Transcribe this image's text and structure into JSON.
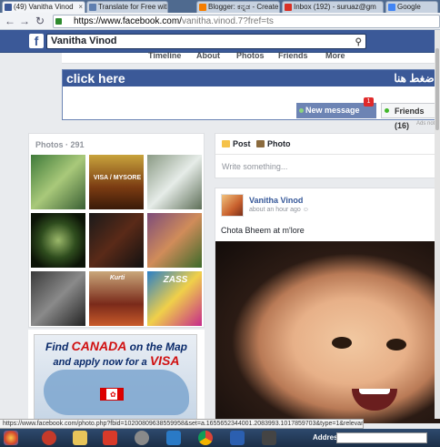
{
  "browser": {
    "tabs": [
      {
        "label": "(49) Vanitha Vinod",
        "color": "#3b5998"
      },
      {
        "label": "Translate for Free with Ka",
        "color": "#5f7fb0"
      },
      {
        "label": "Blogger: ಕನ್ನಡ - Create",
        "color": "#f57d00"
      },
      {
        "label": "Inbox (192) - suruaz@gm",
        "color": "#d93025"
      },
      {
        "label": "Google",
        "color": "#4285f4"
      }
    ],
    "url_host": "https://www.facebook.com/",
    "url_rest": "vanitha.vinod.7?fref=ts",
    "status_url": "https://www.facebook.com/photo.php?fbid=10200809638559958&set=a.1655652344001.2083993.1017859703&type=1&relevant_count=1"
  },
  "fb": {
    "search_value": "Vanitha Vinod",
    "logo": "f",
    "profile_nav": [
      "Timeline",
      "About",
      "Photos",
      "Friends",
      "More"
    ]
  },
  "ad_banner": {
    "click_here": "click here",
    "arabic": "اضغط هنا",
    "new_message": "New message",
    "badge": "1",
    "friends": "Friends (16)",
    "note": "Ads not b"
  },
  "photos": {
    "header": "Photos",
    "count": "· 291",
    "captions": [
      "",
      "VISA / MYSORE",
      "",
      "",
      "",
      "",
      "",
      "Kurti",
      "ZASS"
    ]
  },
  "canada_ad": {
    "line1a": "Find ",
    "line1b": "CANADA",
    "line1c": " on the Map",
    "line2": "and apply now for a ",
    "line2b": "VISA"
  },
  "composer": {
    "post_tab": "Post",
    "photo_tab": "Photo",
    "placeholder": "Write something..."
  },
  "post": {
    "author": "Vanitha Vinod",
    "time": "about an hour ago",
    "text": "Chota Bheem at m'lore"
  },
  "taskbar": {
    "address_label": "Address"
  }
}
